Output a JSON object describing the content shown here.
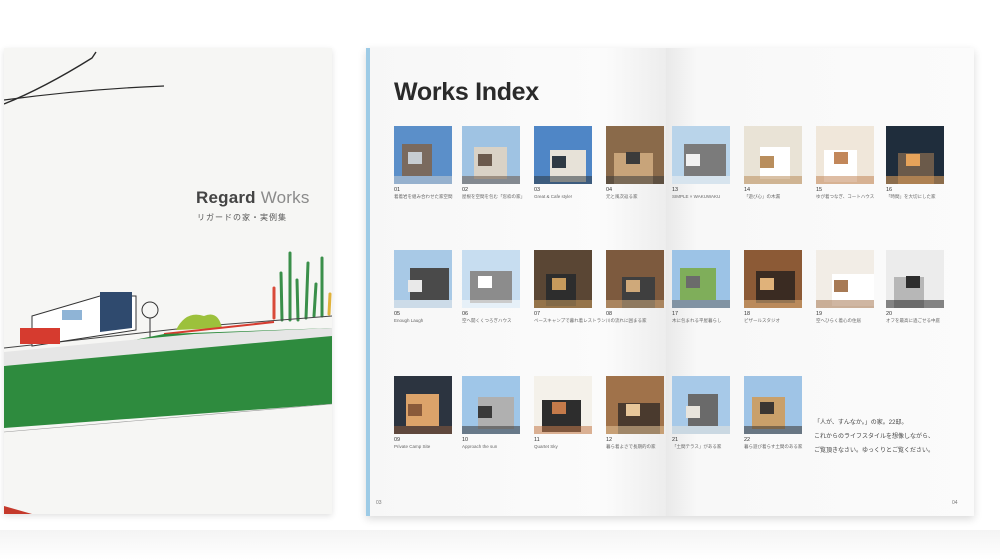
{
  "cover": {
    "title_part1": "Regard ",
    "title_part2": "Works",
    "subtitle": "リガードの家・実例集"
  },
  "index": {
    "title": "Works Index",
    "page_left": "03",
    "page_right": "04",
    "message_lines": [
      "「人が、すんなか。」の家。22邸。",
      "これからのライフスタイルを想像しながら、",
      "ご覧頂きなさい。ゆっくりとご覧ください。"
    ],
    "works": [
      {
        "num": "01",
        "caption": "着着岩を組み合わせた家空間",
        "palette": [
          "#5b8fc9",
          "#c7cdd2",
          "#7a6a5e"
        ]
      },
      {
        "num": "02",
        "caption": "屋根を空間を包む「窓枠の家」",
        "palette": [
          "#9fc3e3",
          "#6b5a4d",
          "#d9d2c6"
        ]
      },
      {
        "num": "03",
        "caption": "Great & Cafe style!",
        "palette": [
          "#4f86c6",
          "#2f3a44",
          "#e7e2d8"
        ]
      },
      {
        "num": "04",
        "caption": "元と風次返る家",
        "palette": [
          "#8a6a4a",
          "#3b3b3b",
          "#c8a47a"
        ]
      },
      {
        "num": "13",
        "caption": "SIMPLE × WAKUWAKU",
        "palette": [
          "#b9d4ea",
          "#f1f1f1",
          "#7b7b7b"
        ]
      },
      {
        "num": "14",
        "caption": "「遊び心」の木漏",
        "palette": [
          "#e9e3d6",
          "#b98e5d",
          "#ffffff"
        ]
      },
      {
        "num": "15",
        "caption": "ゆが着つなぎ、コートハウス",
        "palette": [
          "#f0e7da",
          "#c2875a",
          "#ffffff"
        ]
      },
      {
        "num": "16",
        "caption": "「時間」を大切にした家",
        "palette": [
          "#1f2d3c",
          "#e6a35a",
          "#6b5a4a"
        ]
      },
      {
        "num": "05",
        "caption": "Enough Laugh",
        "palette": [
          "#a8c9e6",
          "#e9e9e9",
          "#4a4a4a"
        ]
      },
      {
        "num": "06",
        "caption": "空へ開くくつろぎハウス",
        "palette": [
          "#c7ddf0",
          "#ffffff",
          "#8c8c8c"
        ]
      },
      {
        "num": "07",
        "caption": "ベースキャンプで暮れ着レストラン",
        "palette": [
          "#5a4634",
          "#c79a5c",
          "#2d2d2d"
        ]
      },
      {
        "num": "08",
        "caption": "川の流れに囲まる家",
        "palette": [
          "#7d5a3e",
          "#cfa97a",
          "#3f3f3f"
        ]
      },
      {
        "num": "17",
        "caption": "木に包まれる平屋暮らし",
        "palette": [
          "#9cc3e6",
          "#6b6b6b",
          "#7fae5a"
        ]
      },
      {
        "num": "18",
        "caption": "ビザールスタジオ",
        "palette": [
          "#8c5a36",
          "#e0b27a",
          "#3a2b22"
        ]
      },
      {
        "num": "19",
        "caption": "空へひらく着心の住居",
        "palette": [
          "#f2ede6",
          "#a77a55",
          "#ffffff"
        ]
      },
      {
        "num": "20",
        "caption": "オフを最高に過ごせる中庭",
        "palette": [
          "#ececec",
          "#2d2d2d",
          "#b7b7b7"
        ]
      },
      {
        "num": "09",
        "caption": "Private Camp Site",
        "palette": [
          "#2c3440",
          "#8a5a3a",
          "#dca36a"
        ]
      },
      {
        "num": "10",
        "caption": "Approach the sun",
        "palette": [
          "#9fc6e8",
          "#3a3a3a",
          "#b0b0b0"
        ]
      },
      {
        "num": "11",
        "caption": "Quartet Sky",
        "palette": [
          "#f4f1ea",
          "#c47a4a",
          "#2d2d2d"
        ]
      },
      {
        "num": "12",
        "caption": "暮ら着よさで長期的の家",
        "palette": [
          "#a0724a",
          "#e8c79a",
          "#4a3a2e"
        ]
      },
      {
        "num": "21",
        "caption": "「土間テラス」がある家",
        "palette": [
          "#a7c9e8",
          "#e8e4dc",
          "#6a6a6a"
        ]
      },
      {
        "num": "22",
        "caption": "暮ら遊び着らす土間のある家",
        "palette": [
          "#9fc4e6",
          "#3b3632",
          "#c9a06a"
        ]
      }
    ]
  }
}
